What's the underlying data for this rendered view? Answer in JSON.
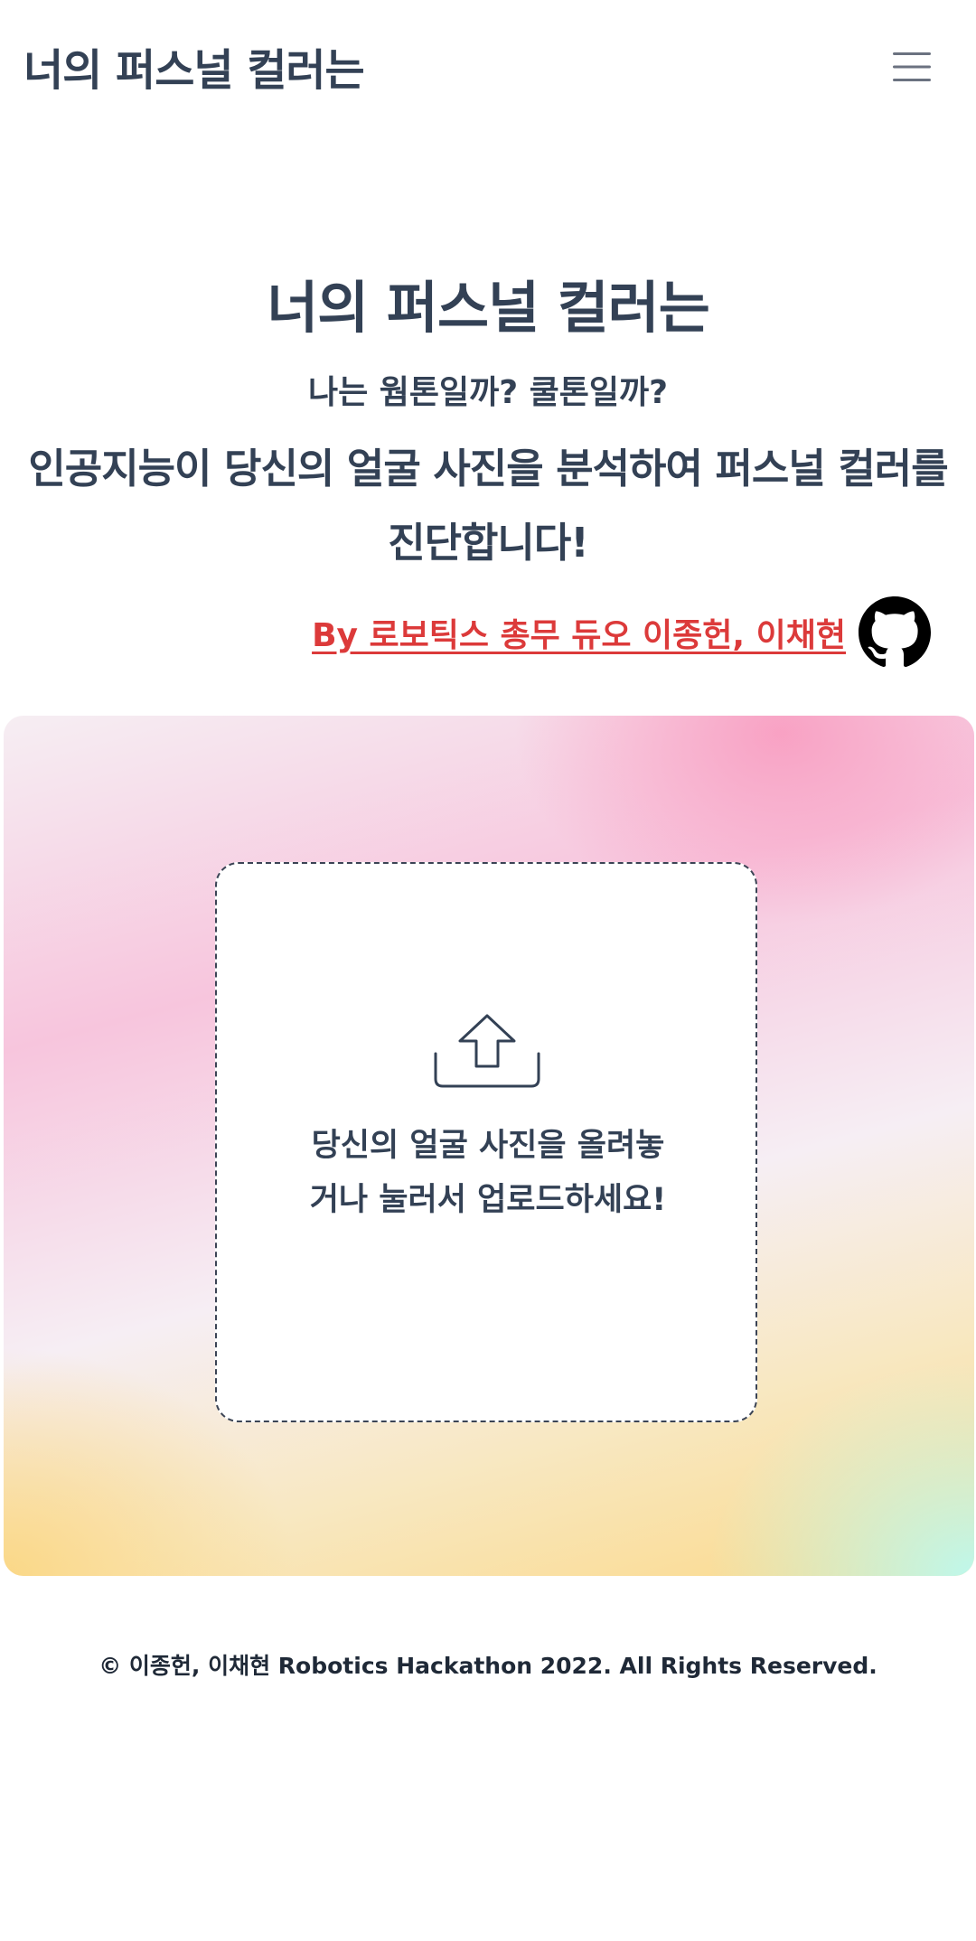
{
  "header": {
    "brand": "너의 퍼스널 컬러는",
    "menu_icon": "hamburger-menu-icon"
  },
  "hero": {
    "title": "너의 퍼스널 컬러는",
    "question": "나는 웜톤일까? 쿨톤일까?",
    "description": "인공지능이 당신의 얼굴 사진을 분석하여 퍼스널 컬러를 진단합니다!",
    "byline": "By 로보틱스 총무 듀오 이종헌, 이채현",
    "github_icon": "github-icon"
  },
  "upload": {
    "icon": "upload-icon",
    "prompt": "당신의 얼굴 사진을 올려놓거나 눌러서 업로드하세요!"
  },
  "footer": {
    "copyright": "© 이종헌, 이채현 Robotics Hackathon 2022. All Rights Reserved."
  },
  "colors": {
    "text": "#334155",
    "link": "#dc3a3a",
    "gradient_pink": "#f999be",
    "gradient_yellow": "#fbd680",
    "gradient_mint": "#bef8ec"
  }
}
